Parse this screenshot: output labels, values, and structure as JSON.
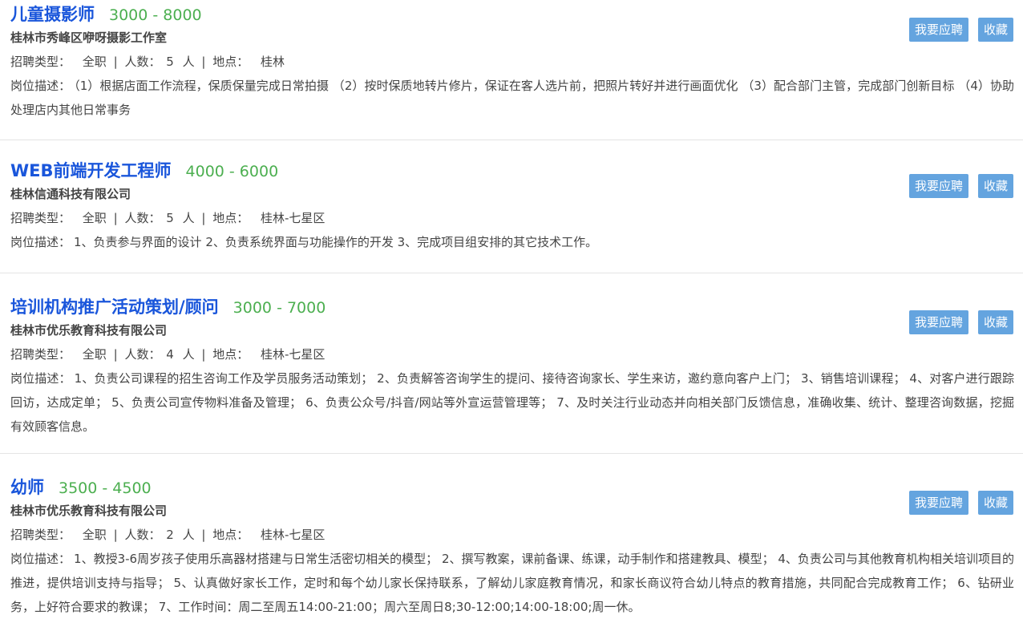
{
  "labels": {
    "type_label": "招聘类型：",
    "count_label": "人数：",
    "location_label": "地点：",
    "desc_label": "岗位描述：",
    "count_unit": "人",
    "separator": "|"
  },
  "buttons": {
    "apply_label": "我要应聘",
    "favorite_label": "收藏"
  },
  "jobs": [
    {
      "title": "儿童摄影师",
      "salary": "3000 - 8000",
      "company": "桂林市秀峰区咿呀摄影工作室",
      "type": "全职",
      "count": "5",
      "location": "桂林",
      "description": "（1）根据店面工作流程，保质保量完成日常拍摄 （2）按时保质地转片修片，保证在客人选片前，把照片转好并进行画面优化 （3）配合部门主管，完成部门创新目标 （4）协助处理店内其他日常事务"
    },
    {
      "title": "WEB前端开发工程师",
      "salary": "4000 - 6000",
      "company": "桂林信通科技有限公司",
      "type": "全职",
      "count": "5",
      "location": "桂林-七星区",
      "description": "1、负责参与界面的设计 2、负责系统界面与功能操作的开发 3、完成项目组安排的其它技术工作。"
    },
    {
      "title": "培训机构推广活动策划/顾问",
      "salary": "3000 - 7000",
      "company": "桂林市优乐教育科技有限公司",
      "type": "全职",
      "count": "4",
      "location": "桂林-七星区",
      "description": "1、负责公司课程的招生咨询工作及学员服务活动策划； 2、负责解答咨询学生的提问、接待咨询家长、学生来访，邀约意向客户上门； 3、销售培训课程； 4、对客户进行跟踪回访，达成定单； 5、负责公司宣传物料准备及管理； 6、负责公众号/抖音/网站等外宣运营管理等； 7、及时关注行业动态并向相关部门反馈信息，准确收集、统计、整理咨询数据，挖掘有效顾客信息。"
    },
    {
      "title": "幼师",
      "salary": "3500 - 4500",
      "company": "桂林市优乐教育科技有限公司",
      "type": "全职",
      "count": "2",
      "location": "桂林-七星区",
      "description": "1、教授3-6周岁孩子使用乐高器材搭建与日常生活密切相关的模型； 2、撰写教案，课前备课、练课，动手制作和搭建教具、模型； 4、负责公司与其他教育机构相关培训项目的推进，提供培训支持与指导； 5、认真做好家长工作，定时和每个幼儿家长保持联系，了解幼儿家庭教育情况，和家长商议符合幼儿特点的教育措施，共同配合完成教育工作； 6、钻研业务，上好符合要求的教课； 7、工作时间：周二至周五14:00-21:00；周六至周日8;30-12:00;14:00-18:00;周一休。"
    }
  ]
}
